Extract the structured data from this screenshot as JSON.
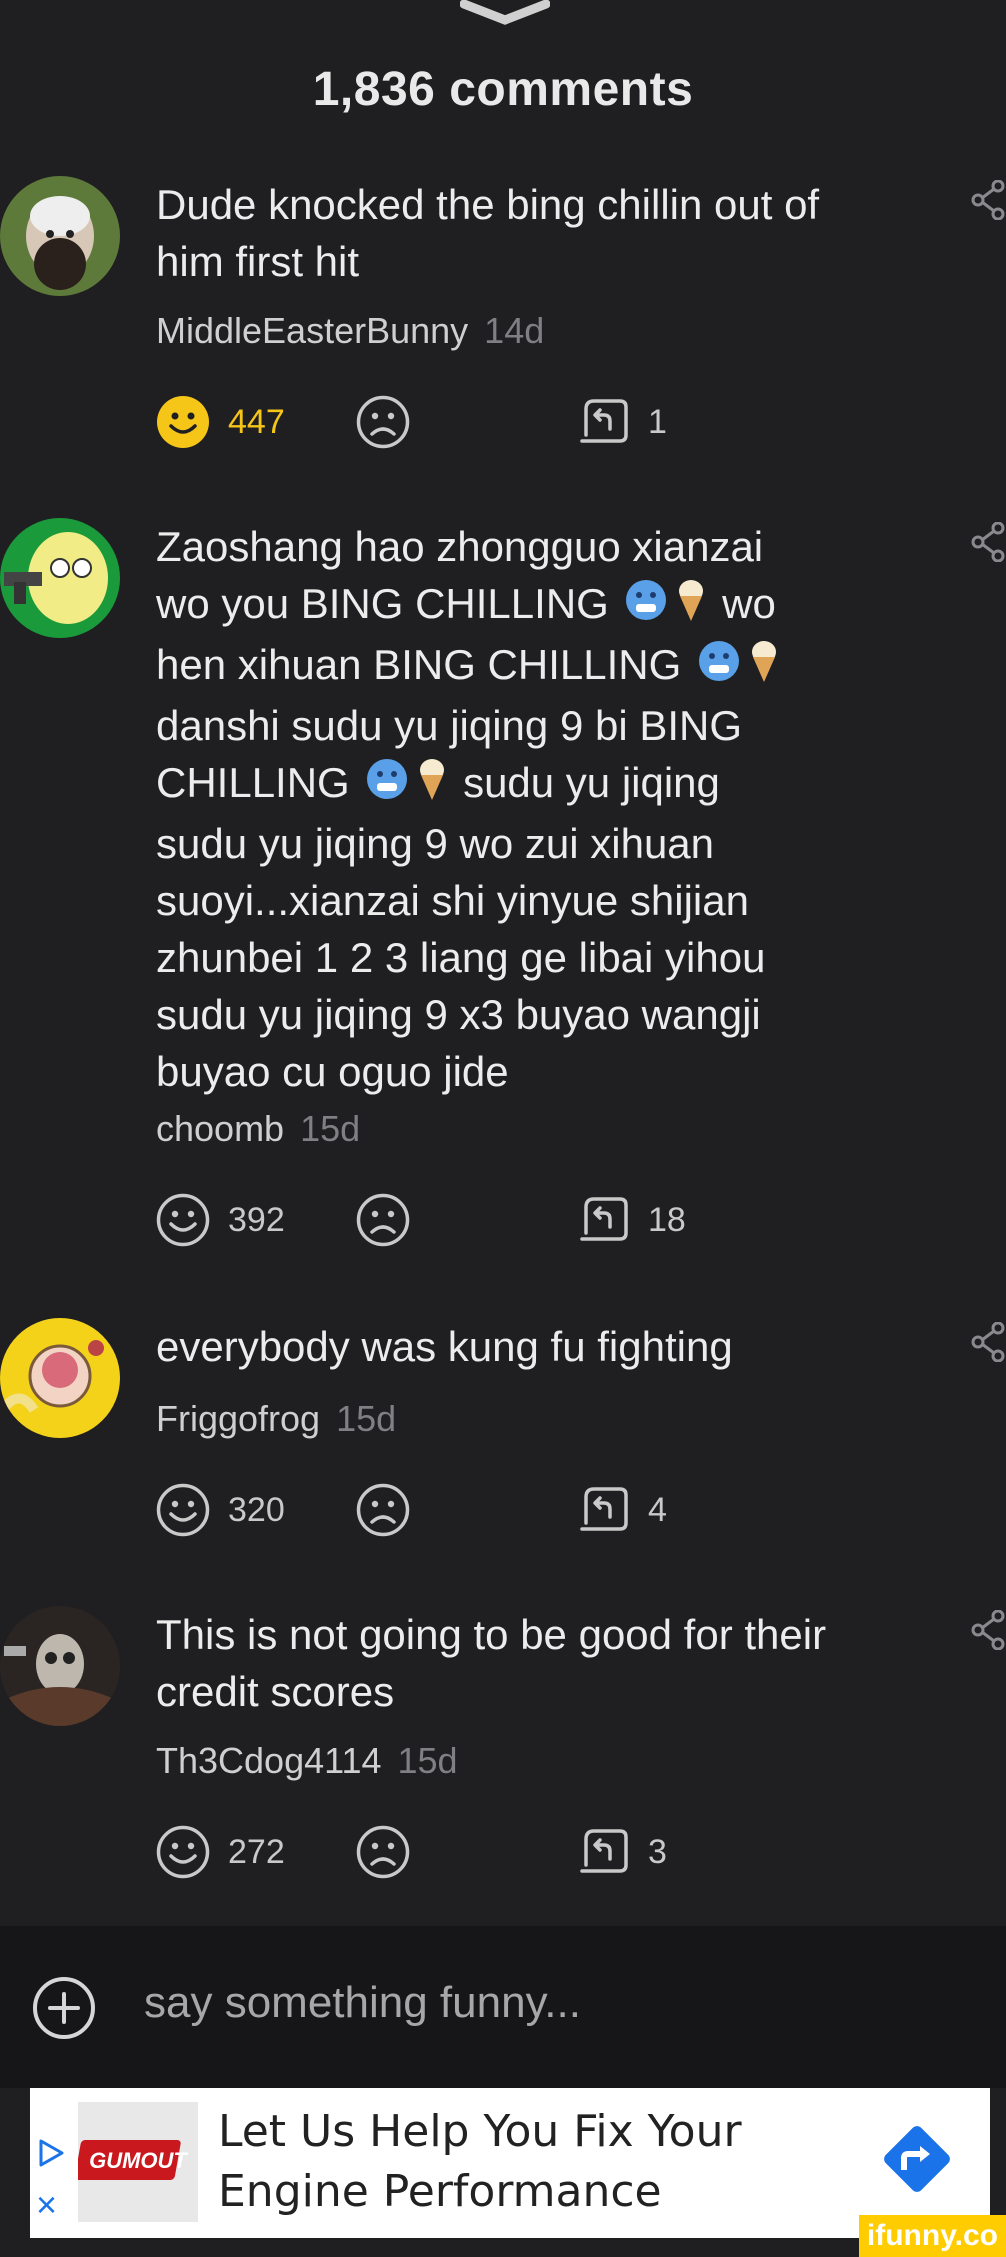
{
  "header": {
    "comments_count": "1,836 comments"
  },
  "comments": [
    {
      "text": "Dude knocked the bing chillin out of him first hit",
      "author": "MiddleEasterBunny",
      "time": "14d",
      "smiles": "447",
      "replies": "1",
      "smile_active": true
    },
    {
      "text_parts": [
        "Zaoshang hao zhongguo xianzai",
        "wo you BING CHILLING",
        "wo",
        "hen xihuan BING CHILLING",
        "danshi sudu yu jiqing 9 bi BING",
        "CHILLING",
        "sudu yu jiqing",
        "sudu yu jiqing 9 wo zui xihuan",
        "suoyi...xianzai shi yinyue shijian",
        "zhunbei 1 2 3 liang ge libai yihou",
        "sudu yu jiqing 9 x3 buyao wangji",
        "buyao cu oguo jide"
      ],
      "author": "choomb",
      "time": "15d",
      "smiles": "392",
      "replies": "18"
    },
    {
      "text": "everybody was kung fu fighting",
      "author": "Friggofrog",
      "time": "15d",
      "smiles": "320",
      "replies": "4"
    },
    {
      "text": "This is not going to be good for their credit scores",
      "author": "Th3Cdog4114",
      "time": "15d",
      "smiles": "272",
      "replies": "3"
    }
  ],
  "input": {
    "placeholder": "say something funny..."
  },
  "ad": {
    "brand": "GUMOUT",
    "line1": "Let Us Help You Fix Your",
    "line2": "Engine Performance",
    "close": "×"
  },
  "watermark": "ifunny.co",
  "colors": {
    "background": "#1f1f21",
    "accent_yellow": "#f5c518",
    "ad_blue": "#1a73e8"
  }
}
